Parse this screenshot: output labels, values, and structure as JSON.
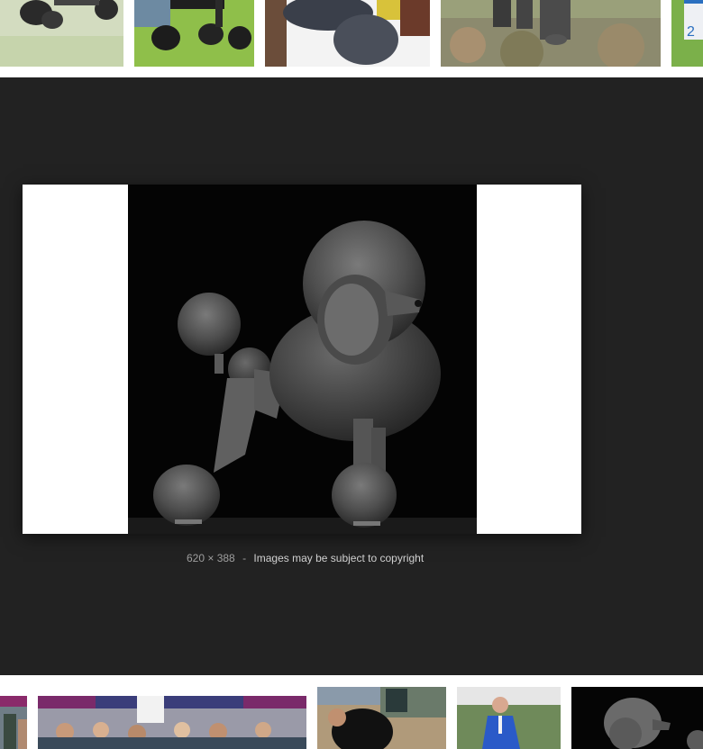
{
  "preview": {
    "dimensions": "620 × 388",
    "separator": "-",
    "copyright_notice": "Images may be subject to copyright"
  },
  "colors": {
    "viewer_background": "#222222",
    "strip_background": "#ffffff",
    "caption_muted": "#9e9e9e",
    "caption_link": "#d0d0d0"
  },
  "top_thumbnails": [
    {
      "subject": "poodle on grass"
    },
    {
      "subject": "black poodle legs on lawn"
    },
    {
      "subject": "grey poodle paws on white"
    },
    {
      "subject": "grey poodle in heather"
    },
    {
      "subject": "show number card",
      "visible_text": "2"
    }
  ],
  "bottom_thumbnails": [
    {
      "subject": "dog show banner"
    },
    {
      "subject": "dog show crowd"
    },
    {
      "subject": "black poodle held by handler"
    },
    {
      "subject": "judge in blue suit"
    },
    {
      "subject": "grey poodle portrait"
    }
  ]
}
